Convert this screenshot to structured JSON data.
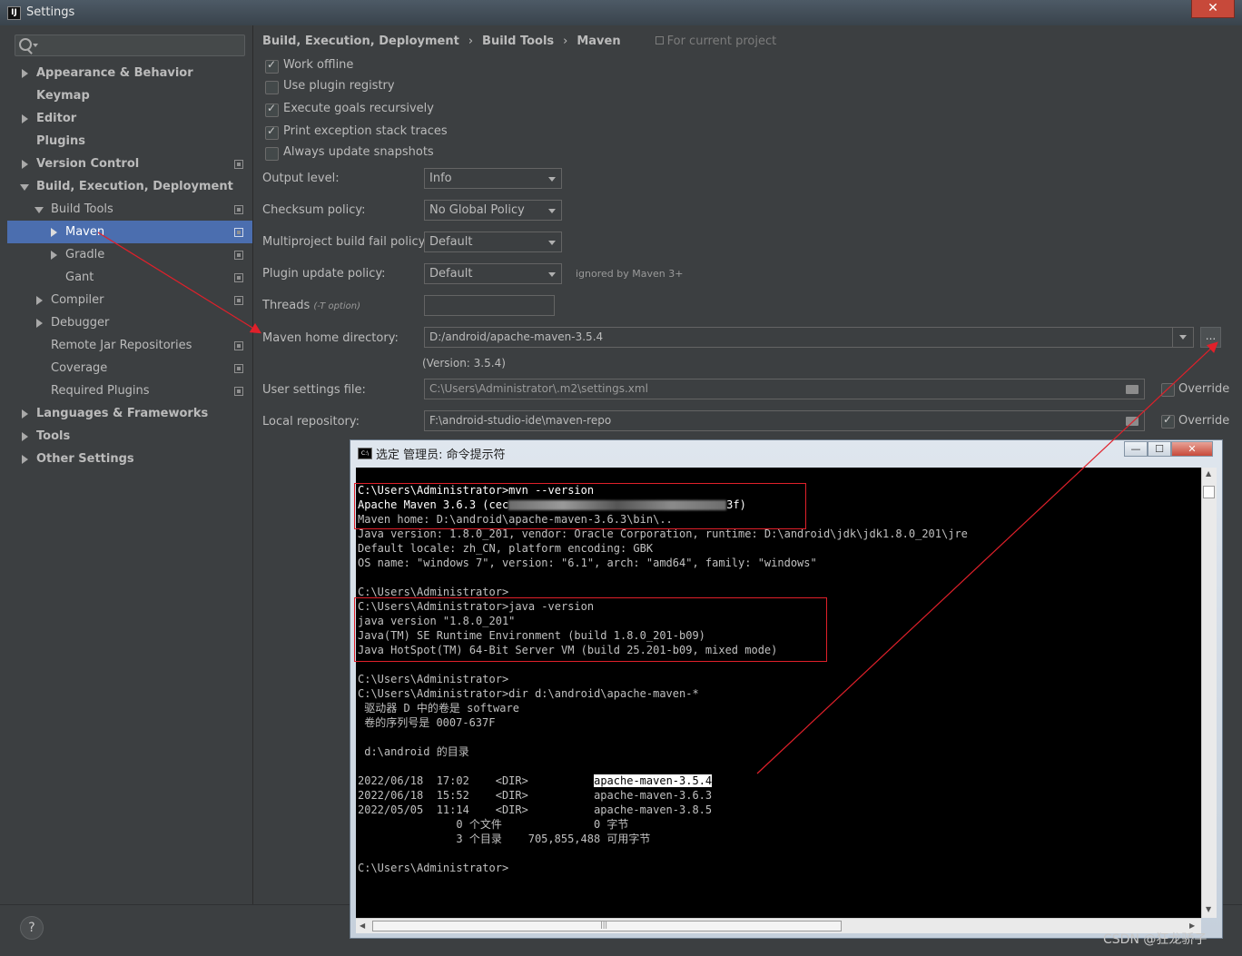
{
  "window": {
    "title": "Settings",
    "close_label": "✕"
  },
  "sidebar": {
    "search_placeholder": "",
    "items": [
      {
        "label": "Appearance & Behavior"
      },
      {
        "label": "Keymap"
      },
      {
        "label": "Editor"
      },
      {
        "label": "Plugins"
      },
      {
        "label": "Version Control"
      },
      {
        "label": "Build, Execution, Deployment"
      },
      {
        "label": "Build Tools"
      },
      {
        "label": "Maven"
      },
      {
        "label": "Gradle"
      },
      {
        "label": "Gant"
      },
      {
        "label": "Compiler"
      },
      {
        "label": "Debugger"
      },
      {
        "label": "Remote Jar Repositories"
      },
      {
        "label": "Coverage"
      },
      {
        "label": "Required Plugins"
      },
      {
        "label": "Languages & Frameworks"
      },
      {
        "label": "Tools"
      },
      {
        "label": "Other Settings"
      }
    ],
    "help_label": "?"
  },
  "breadcrumb": {
    "items": [
      "Build, Execution, Deployment",
      "Build Tools",
      "Maven"
    ],
    "separator": "›",
    "note": "For current project"
  },
  "maven": {
    "checkboxes": [
      {
        "label": "Work offline",
        "checked": true
      },
      {
        "label": "Use plugin registry",
        "checked": false
      },
      {
        "label": "Execute goals recursively",
        "checked": true
      },
      {
        "label": "Print exception stack traces",
        "checked": true
      },
      {
        "label": "Always update snapshots",
        "checked": false
      }
    ],
    "output_level": {
      "label": "Output level:",
      "value": "Info"
    },
    "checksum_policy": {
      "label": "Checksum policy:",
      "value": "No Global Policy"
    },
    "multiproject_fail_policy": {
      "label": "Multiproject build fail policy:",
      "value": "Default"
    },
    "plugin_update_policy": {
      "label": "Plugin update policy:",
      "value": "Default",
      "hint": "ignored by Maven 3+"
    },
    "threads": {
      "label": "Threads",
      "hint": "(-T option)",
      "value": ""
    },
    "home_directory": {
      "label": "Maven home directory:",
      "value": "D:/android/apache-maven-3.5.4",
      "version": "(Version: 3.5.4)",
      "browse_label": "..."
    },
    "user_settings": {
      "label": "User settings file:",
      "value": "C:\\Users\\Administrator\\.m2\\settings.xml",
      "override_label": "Override",
      "override_checked": false
    },
    "local_repository": {
      "label": "Local repository:",
      "value": "F:\\android-studio-ide\\maven-repo",
      "override_label": "Override",
      "override_checked": true
    }
  },
  "cmd": {
    "title": "选定 管理员: 命令提示符",
    "icon_text": "C:\\",
    "minimize_label": "—",
    "maximize_label": "☐",
    "close_label": "✕",
    "lines": [
      "C:\\Users\\Administrator>mvn --version",
      "Apache Maven 3.6.3 (cec",
      "3f)",
      "Maven home: D:\\android\\apache-maven-3.6.3\\bin\\..",
      "Java version: 1.8.0_201, vendor: Oracle Corporation, runtime: D:\\android\\jdk\\jdk1.8.0_201\\jre",
      "Default locale: zh_CN, platform encoding: GBK",
      "OS name: \"windows 7\", version: \"6.1\", arch: \"amd64\", family: \"windows\"",
      "",
      "C:\\Users\\Administrator>",
      "C:\\Users\\Administrator>java -version",
      "java version \"1.8.0_201\"",
      "Java(TM) SE Runtime Environment (build 1.8.0_201-b09)",
      "Java HotSpot(TM) 64-Bit Server VM (build 25.201-b09, mixed mode)",
      "",
      "C:\\Users\\Administrator>",
      "C:\\Users\\Administrator>dir d:\\android\\apache-maven-*",
      " 驱动器 D 中的卷是 software",
      " 卷的序列号是 0007-637F",
      "",
      " d:\\android 的目录",
      "",
      "2022/06/18  17:02    <DIR>          ",
      "apache-maven-3.5.4",
      "2022/06/18  15:52    <DIR>          apache-maven-3.6.3",
      "2022/05/05  11:14    <DIR>          apache-maven-3.8.5",
      "               0 个文件              0 字节",
      "               3 个目录    705,855,488 可用字节",
      "",
      "C:\\Users\\Administrator>"
    ],
    "scroll_glyph": "|||"
  },
  "watermark": "CSDN @狂龙骄子",
  "colors": {
    "selection": "#4b6eaf",
    "annotation_red": "#e0202a",
    "console_bg": "#000000"
  }
}
